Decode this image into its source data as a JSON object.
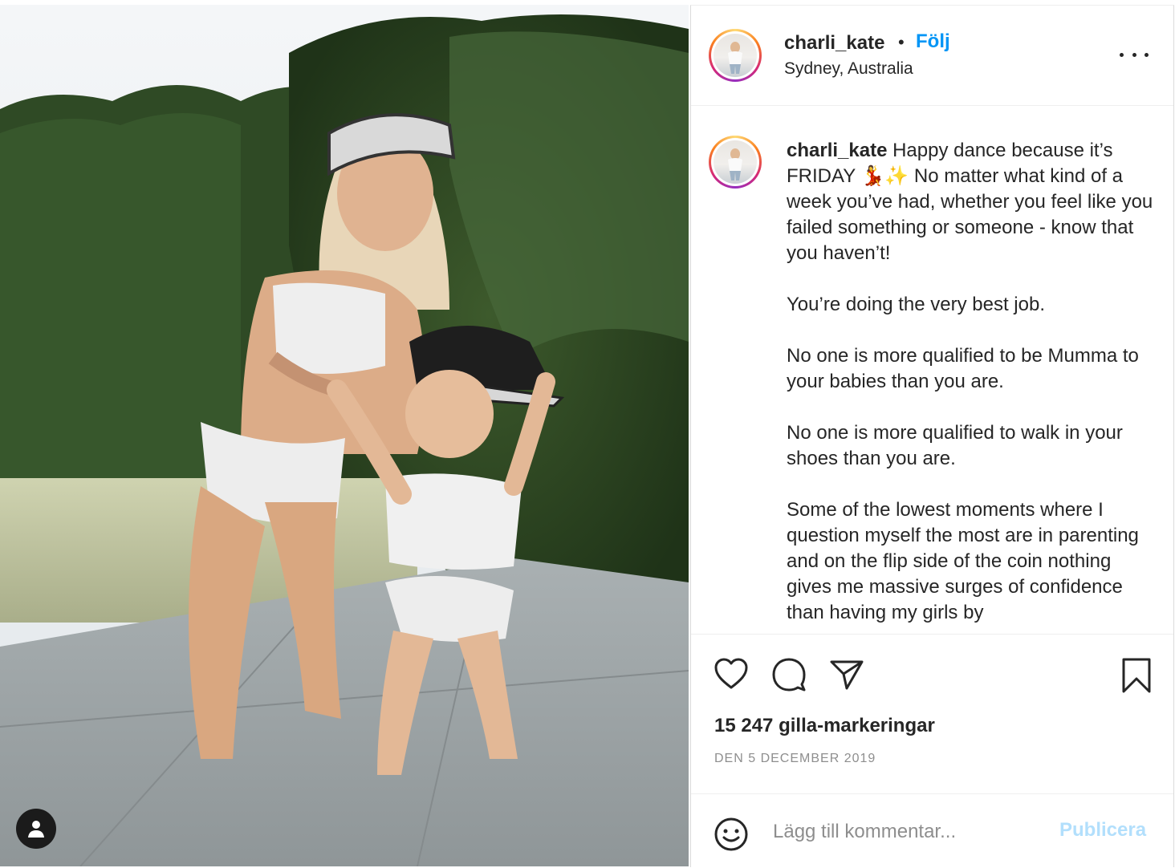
{
  "post": {
    "username": "charli_kate",
    "separator": "•",
    "follow_label": "Följ",
    "location": "Sydney, Australia",
    "more_icon": "more-horizontal-icon"
  },
  "caption": {
    "username": "charli_kate",
    "lines": [
      "Happy dance because it’s FRIDAY 💃✨ No matter what kind of a week you’ve had, whether you feel like you failed something or someone - know that you haven’t!",
      "You’re doing the very best job.",
      "No one is more qualified to be Mumma to your babies than you are.",
      "No one is more qualified to walk in your shoes than you are.",
      "Some of the lowest moments where I question myself the most are in parenting and on the flip side of the coin nothing gives me massive surges of confidence than having my girls by"
    ]
  },
  "actions": {
    "icons": [
      "heart-icon",
      "comment-icon",
      "share-icon",
      "bookmark-icon"
    ],
    "likes": "15 247 gilla-markeringar",
    "date": "DEN 5 DECEMBER 2019"
  },
  "comment_box": {
    "placeholder": "Lägg till kommentar...",
    "publish_label": "Publicera",
    "emoji_icon": "smiley-icon"
  },
  "photo": {
    "tag_icon": "user-tag-icon"
  }
}
